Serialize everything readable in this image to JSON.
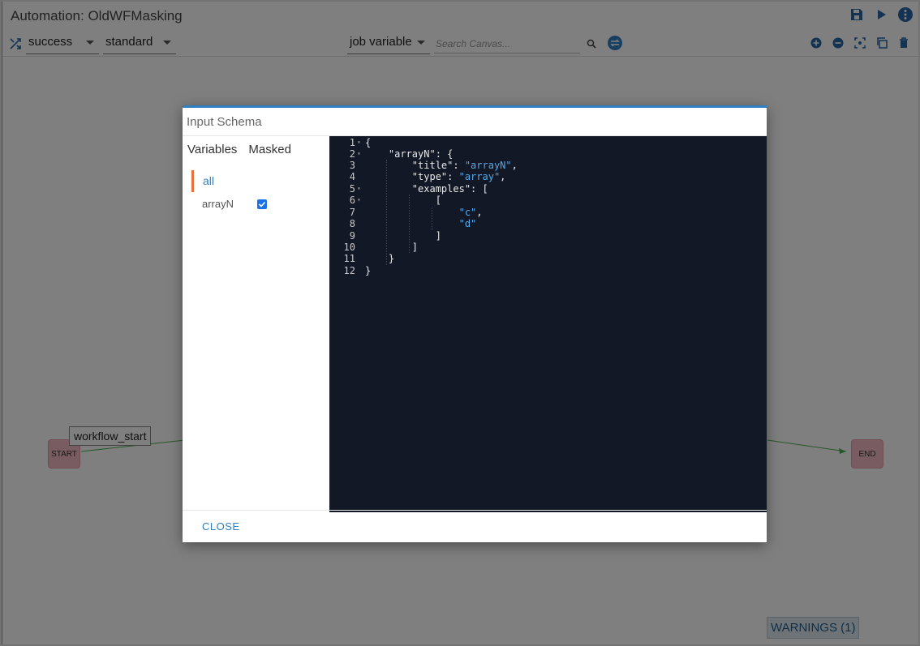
{
  "titlebar": {
    "title": "Automation: OldWFMasking",
    "icons": [
      "save-icon",
      "play-icon",
      "more-vert-icon"
    ]
  },
  "toolbar": {
    "status_select": "success",
    "type_select": "standard",
    "variable_select": "job variable",
    "search_placeholder": "Search Canvas...",
    "right_icons": [
      "zoom-in-icon",
      "zoom-out-icon",
      "fit-screen-icon",
      "copy-icon",
      "delete-icon"
    ]
  },
  "canvas": {
    "start_label": "START",
    "end_label": "END",
    "tooltip": "workflow_start",
    "warnings": "WARNINGS (1)"
  },
  "modal": {
    "title": "Input Schema",
    "variables_header": "Variables",
    "masked_header": "Masked",
    "items": [
      {
        "label": "all",
        "masked": null
      },
      {
        "label": "arrayN",
        "masked": true
      }
    ],
    "code_lines": [
      "{",
      "    \"arrayN\": {",
      "        \"title\": \"arrayN\",",
      "        \"type\": \"array\",",
      "        \"examples\": [",
      "            [",
      "                \"c\",",
      "                \"d\"",
      "            ]",
      "        ]",
      "    }",
      "}"
    ],
    "line_numbers": [
      "1",
      "2",
      "3",
      "4",
      "5",
      "6",
      "7",
      "8",
      "9",
      "10",
      "11",
      "12"
    ],
    "close_label": "CLOSE"
  },
  "colors": {
    "accent": "#2f7fc1",
    "active_indicator": "#e8703a",
    "editor_bg": "#121826",
    "node_fill": "#f3b8c3"
  }
}
